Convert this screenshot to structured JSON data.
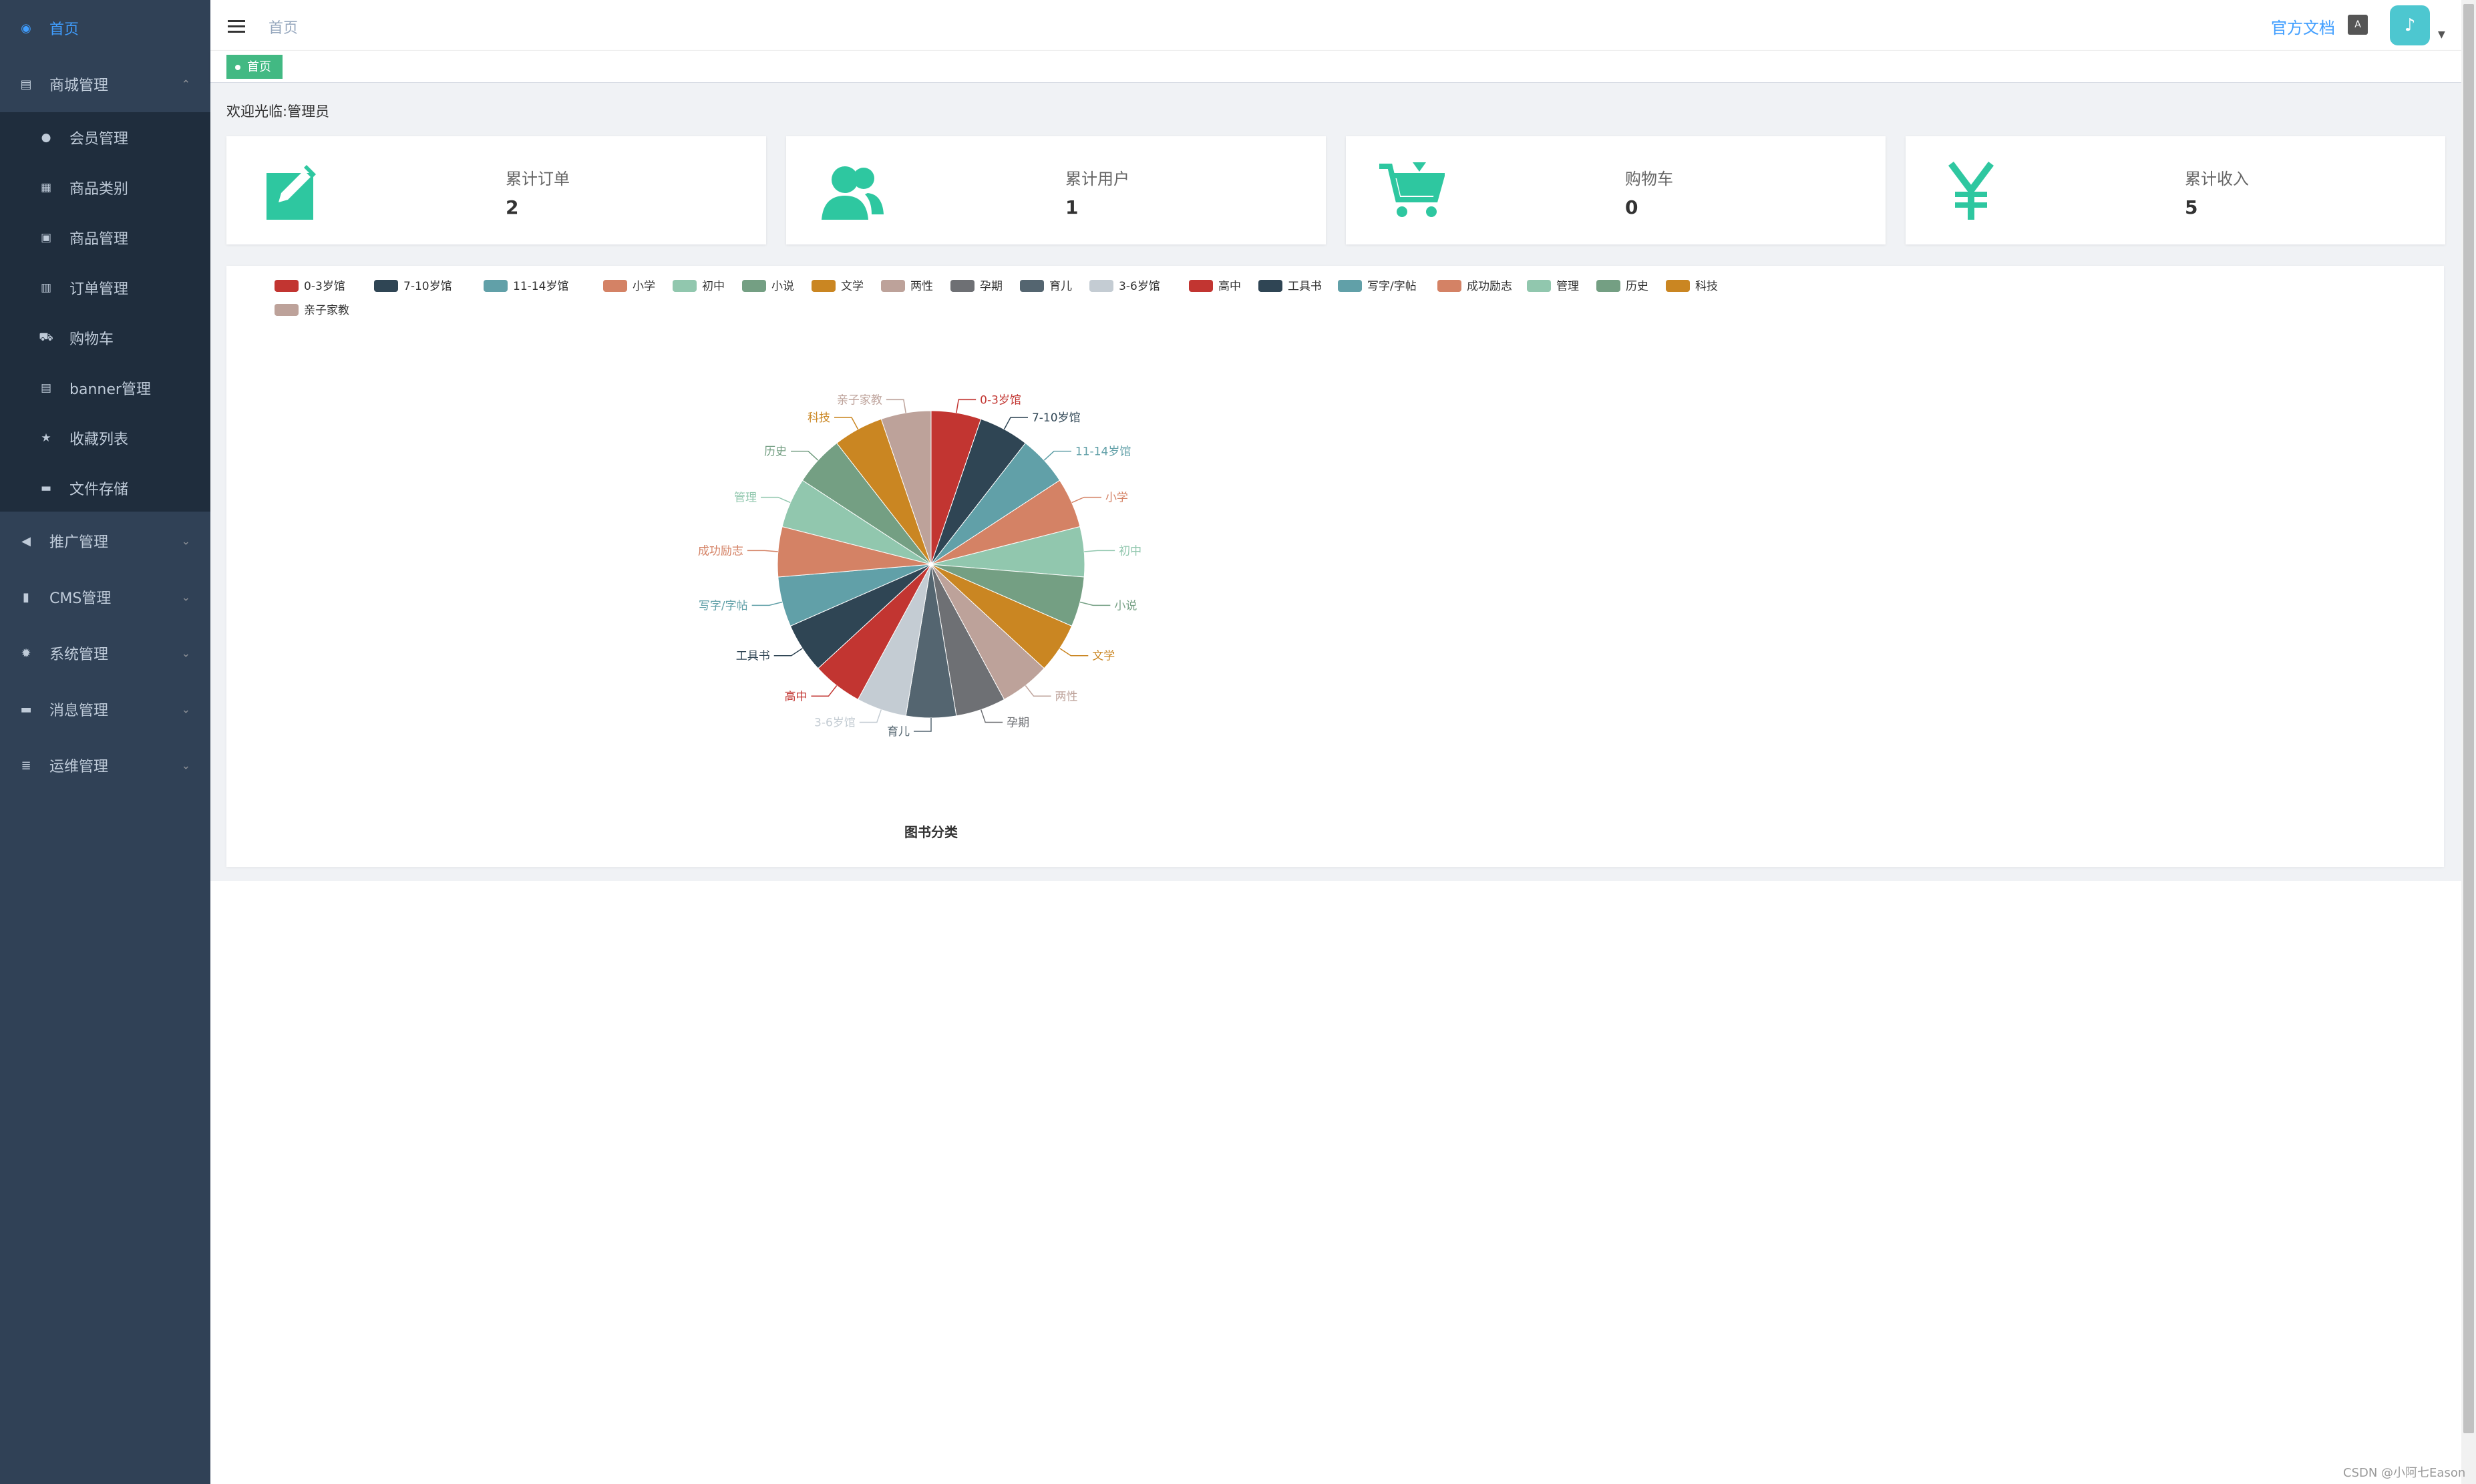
{
  "sidebar": {
    "items": [
      {
        "label": "首页",
        "icon": "dashboard-icon"
      },
      {
        "label": "商城管理",
        "icon": "shop-icon"
      },
      {
        "label": "推广管理",
        "icon": "megaphone-icon"
      },
      {
        "label": "CMS管理",
        "icon": "document-icon"
      },
      {
        "label": "系统管理",
        "icon": "gear-icon"
      },
      {
        "label": "消息管理",
        "icon": "message-icon"
      },
      {
        "label": "运维管理",
        "icon": "server-icon"
      }
    ],
    "sub_items": [
      {
        "label": "会员管理",
        "icon": "user-icon"
      },
      {
        "label": "商品类别",
        "icon": "grid-icon"
      },
      {
        "label": "商品管理",
        "icon": "image-icon"
      },
      {
        "label": "订单管理",
        "icon": "clipboard-icon"
      },
      {
        "label": "购物车",
        "icon": "cart-icon"
      },
      {
        "label": "banner管理",
        "icon": "banner-icon"
      },
      {
        "label": "收藏列表",
        "icon": "star-icon"
      },
      {
        "label": "文件存储",
        "icon": "folder-icon"
      }
    ]
  },
  "header": {
    "breadcrumb": "首页",
    "doc_link": "官方文档",
    "lang_icon": "A",
    "tag": "首页"
  },
  "main": {
    "welcome": "欢迎光临:管理员",
    "cards": [
      {
        "title": "累计订单",
        "value": "2",
        "icon": "edit-icon"
      },
      {
        "title": "累计用户",
        "value": "1",
        "icon": "users-icon"
      },
      {
        "title": "购物车",
        "value": "0",
        "icon": "cart-icon"
      },
      {
        "title": "累计收入",
        "value": "5",
        "icon": "yen-icon"
      }
    ]
  },
  "colors": {
    "sidebar_bg": "#304156",
    "accent": "#409eff",
    "card_icon": "#2ec7a0",
    "tag_bg": "#42b983"
  },
  "chart_data": {
    "type": "pie",
    "title": "图书分类",
    "legend_position": "top-left",
    "categories": [
      "0-3岁馆",
      "7-10岁馆",
      "11-14岁馆",
      "小学",
      "初中",
      "小说",
      "文学",
      "两性",
      "孕期",
      "育儿",
      "3-6岁馆",
      "高中",
      "工具书",
      "写字/字帖",
      "成功励志",
      "管理",
      "历史",
      "科技",
      "亲子家教"
    ],
    "values": [
      1,
      1,
      1,
      1,
      1,
      1,
      1,
      1,
      1,
      1,
      1,
      1,
      1,
      1,
      1,
      1,
      1,
      1,
      1
    ],
    "colors": [
      "#c23531",
      "#2f4554",
      "#61a0a8",
      "#d48265",
      "#91c7ae",
      "#749f83",
      "#ca8622",
      "#bda29a",
      "#6e7074",
      "#546570",
      "#c4ccd3",
      "#c23531",
      "#2f4554",
      "#61a0a8",
      "#d48265",
      "#91c7ae",
      "#749f83",
      "#ca8622",
      "#bda29a"
    ]
  },
  "watermark": "CSDN @小阿七Eason"
}
